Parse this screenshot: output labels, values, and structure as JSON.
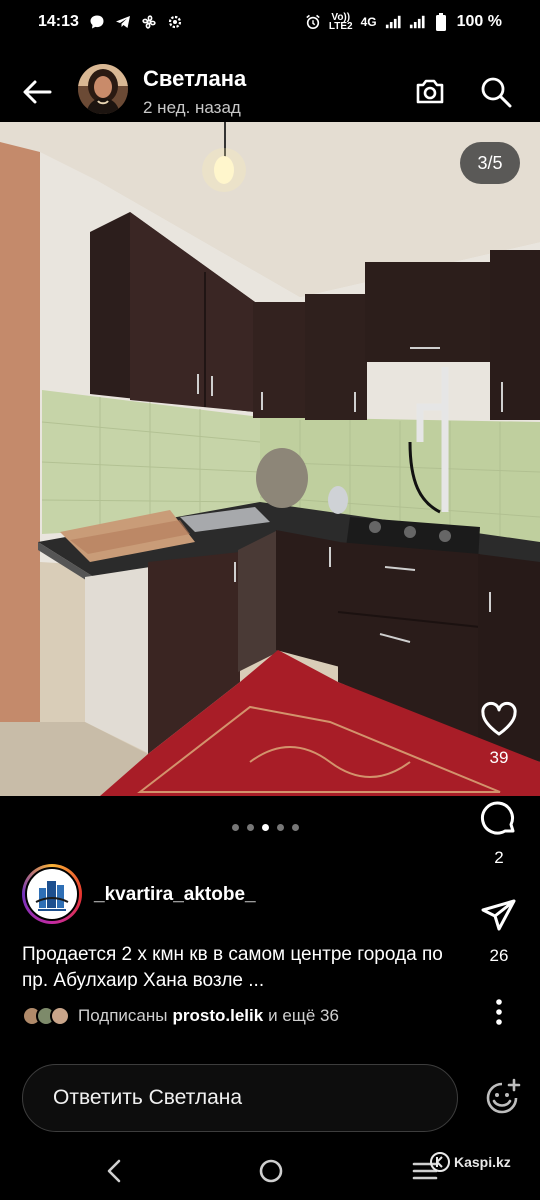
{
  "status_bar": {
    "time": "14:13",
    "left_icons": [
      "chat-bubble-icon",
      "telegram-icon",
      "fan-icon",
      "gear-icon"
    ],
    "volte_top": "Vo))",
    "volte_bottom": "LTE2",
    "network": "4G",
    "battery_text": "100 %"
  },
  "header": {
    "author_name": "Светлана",
    "time_ago": "2 нед. назад"
  },
  "photo": {
    "counter": "3/5"
  },
  "pagination": {
    "count": 5,
    "active_index": 2
  },
  "actions": {
    "likes": "39",
    "comments": "2",
    "shares": "26"
  },
  "post": {
    "account": "_kvartira_aktobe_",
    "caption": "Продается 2 х кмн кв в самом центре города по пр. Абулхаир Хана возле ...",
    "followed_prefix": "Подписаны",
    "followed_user": "prosto.lelik",
    "followed_suffix": "и ещё 36"
  },
  "reply": {
    "placeholder": "Ответить Светлана"
  },
  "watermark": "Kaspi.kz",
  "colors": {
    "background": "#000000",
    "text_primary": "#ffffff",
    "text_secondary": "#c8c8c8",
    "pill_bg": "#3c3c3c"
  }
}
